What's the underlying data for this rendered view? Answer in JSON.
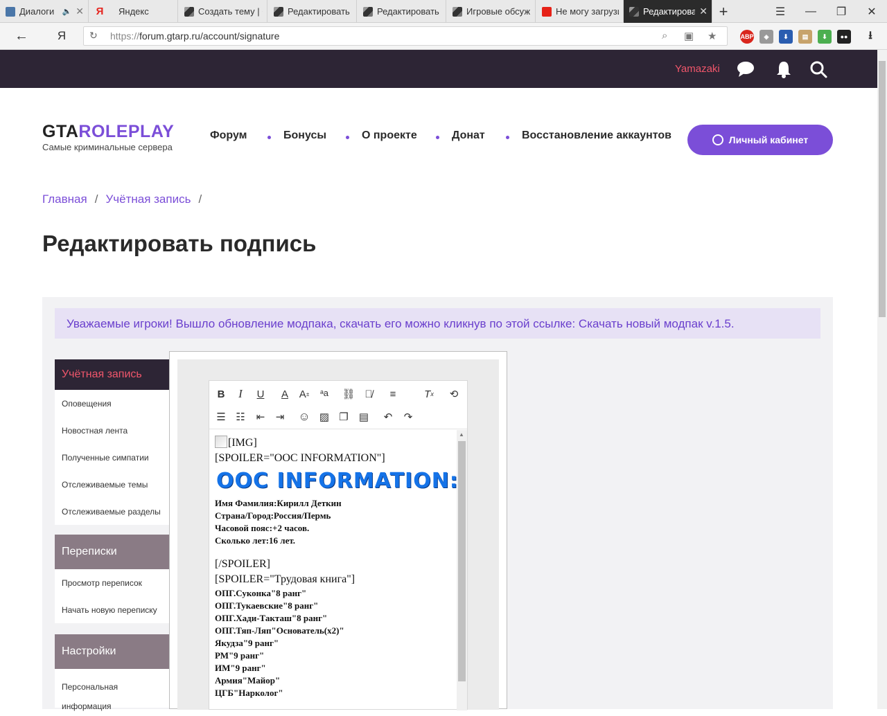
{
  "browser": {
    "tabs": [
      {
        "title": "Диалоги",
        "favicon": "vk-icon"
      },
      {
        "title": "Яндекс",
        "favicon": "yandex-icon"
      },
      {
        "title": "Создать тему | G",
        "favicon": "gta-icon"
      },
      {
        "title": "Редактировать",
        "favicon": "gta-icon"
      },
      {
        "title": "Редактировать",
        "favicon": "gta-icon"
      },
      {
        "title": "Игровые обсуж",
        "favicon": "gta-icon"
      },
      {
        "title": "Не могу загрузи",
        "favicon": "youtube-icon"
      },
      {
        "title": "Редактирова",
        "favicon": "gta-icon",
        "active": true
      }
    ],
    "new_tab": "+",
    "url_scheme": "https://",
    "url_rest": "forum.gtarp.ru/account/signature",
    "back": "←",
    "yandex_logo": "Я",
    "reload": "↻",
    "ext_abp": "ABP"
  },
  "site": {
    "username": "Yamazaki",
    "logo_part1": "GTA",
    "logo_part2": "ROLEPLAY",
    "logo_subtitle": "Самые криминальные сервера",
    "nav": [
      "Форум",
      "Бонусы",
      "О проекте",
      "Донат",
      "Восстановление аккаунтов"
    ],
    "cabinet_button": "Личный кабинет",
    "breadcrumb": [
      "Главная",
      "Учётная запись"
    ],
    "breadcrumb_sep": "/",
    "page_title": "Редактировать подпись",
    "notice": "Уважаемые игроки! Вышло обновление модпака, скачать его можно кликнув по этой ссылке: Скачать новый модпак v.1.5."
  },
  "sidebar": {
    "account": {
      "title": "Учётная запись",
      "items": [
        "Оповещения",
        "Новостная лента",
        "Полученные симпатии",
        "Отслеживаемые темы",
        "Отслеживаемые разделы"
      ]
    },
    "messages": {
      "title": "Переписки",
      "items": [
        "Просмотр переписок",
        "Начать новую переписку"
      ]
    },
    "settings": {
      "title": "Настройки",
      "items": [
        "Персональная информация"
      ]
    }
  },
  "editor": {
    "toolbar_row1": [
      "bold-icon",
      "italic-icon",
      "underline-icon",
      "text-color-icon",
      "font-size-icon",
      "font-family-icon",
      "link-icon",
      "unlink-icon",
      "align-icon",
      "clear-format-icon",
      "draft-icon"
    ],
    "toolbar_row2": [
      "bullet-list-icon",
      "numbered-list-icon",
      "outdent-icon",
      "indent-icon",
      "smilie-icon",
      "image-icon",
      "media-icon",
      "insert-icon",
      "undo-icon",
      "redo-icon"
    ],
    "content": {
      "img_alt": "[IMG]",
      "spoiler1_open": "[SPOILER=\"OOC INFORMATION\"]",
      "ooc_heading": "OOC INFORMATION:",
      "ooc_lines": [
        "Имя Фамилия:Кирилл Деткин",
        "Страна/Город:Россия/Пермь",
        "Часовой пояс:+2 часов.",
        "Сколько лет:16 лет."
      ],
      "spoiler_close": "[/SPOILER]",
      "spoiler2_open": "[SPOILER=\"Трудовая книга\"]",
      "work_lines": [
        "ОПГ.Суконка\"8 ранг\"",
        "ОПГ.Тукаевские\"8 ранг\"",
        "ОПГ.Хади-Такташ\"8 ранг\"",
        "ОПГ.Тяп-Ляп\"Основатель(х2)\"",
        "Якудза\"9 ранг\"",
        "РМ\"9 ранг\"",
        "ИМ\"9 ранг\"",
        "Армия\"Майор\"",
        "ЦГБ\"Нарколог\""
      ]
    }
  },
  "colors": {
    "accent": "#7b4ed8",
    "header_bg": "#2d2535",
    "username": "#f0566b"
  }
}
